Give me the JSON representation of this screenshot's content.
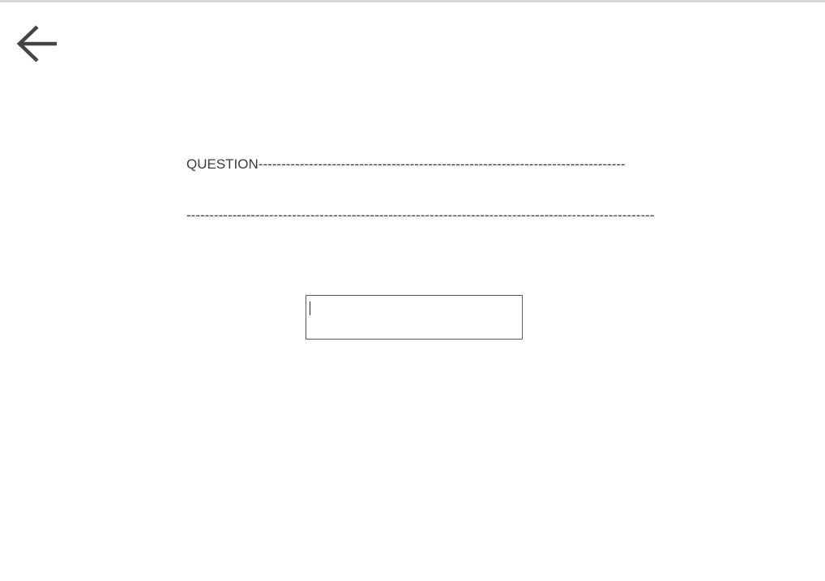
{
  "header": {
    "back_icon": "arrow-left-icon"
  },
  "question": {
    "line1": "QUESTION--------------------------------------------------------------------------------",
    "line2": "------------------------------------------------------------------------------------------------------"
  },
  "answer": {
    "value": "",
    "placeholder": ""
  },
  "colors": {
    "text": "#3c3c3c",
    "icon": "#444444",
    "input_border": "#5a5a5a",
    "top_rule": "#d9d9d9"
  }
}
